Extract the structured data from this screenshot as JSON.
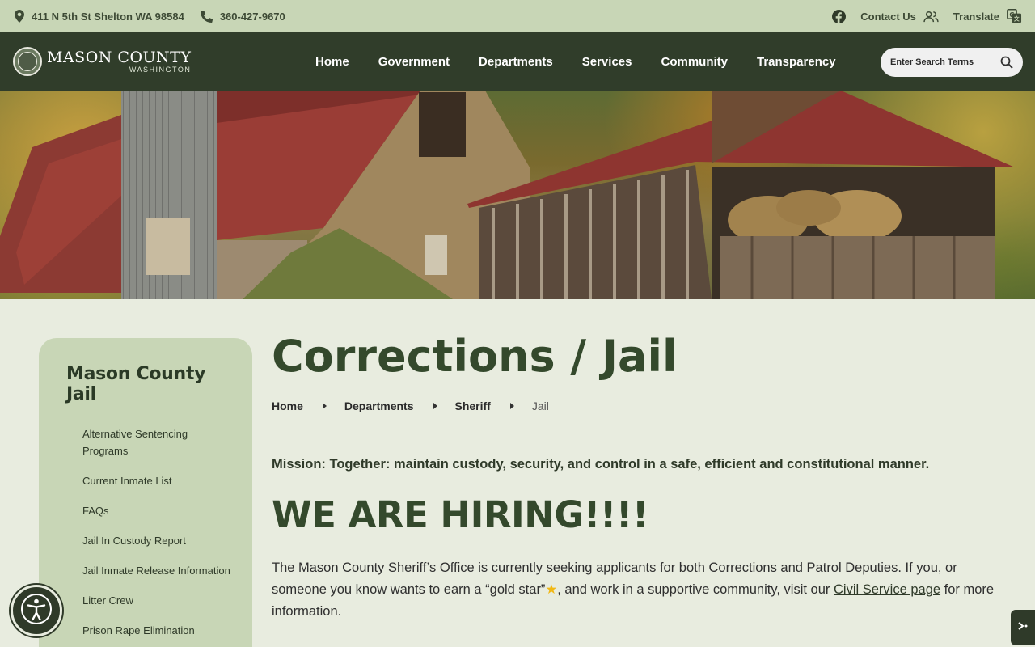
{
  "utility": {
    "address": "411 N 5th St Shelton WA 98584",
    "phone": "360-427-9670",
    "contact_label": "Contact Us",
    "translate_label": "Translate",
    "icons": {
      "location": "map-pin-icon",
      "phone": "phone-icon",
      "facebook": "facebook-icon",
      "contact": "people-icon",
      "translate": "translate-icon"
    }
  },
  "header": {
    "logo_main": "MASON COUNTY",
    "logo_sub": "WASHINGTON",
    "nav": [
      "Home",
      "Government",
      "Departments",
      "Services",
      "Community",
      "Transparency"
    ],
    "search_placeholder": "Enter Search Terms"
  },
  "sidebar": {
    "title": "Mason County Jail",
    "items": [
      "Alternative Sentencing Programs",
      "Current Inmate List",
      "FAQs",
      "Jail In Custody Report",
      "Jail Inmate Release Information",
      "Litter Crew",
      "Prison Rape Elimination"
    ]
  },
  "main": {
    "title": "Corrections / Jail",
    "breadcrumb": [
      "Home",
      "Departments",
      "Sheriff",
      "Jail"
    ],
    "mission": "Mission: Together: maintain custody, security, and control in a safe, efficient and constitutional manner.",
    "hiring": "WE ARE HIRING!!!!",
    "para_before": "The Mason County Sheriff’s Office is currently seeking applicants for both Corrections and Patrol Deputies. If you, or someone you know wants to earn a “gold star”",
    "para_mid": ", and work in a supportive community, visit our ",
    "para_link": "Civil Service page",
    "para_after": " for more information."
  },
  "colors": {
    "header_bg": "#303d2a",
    "utility_bg": "#c8d6b6",
    "page_bg": "#e8ecdf",
    "title": "#34492c"
  }
}
